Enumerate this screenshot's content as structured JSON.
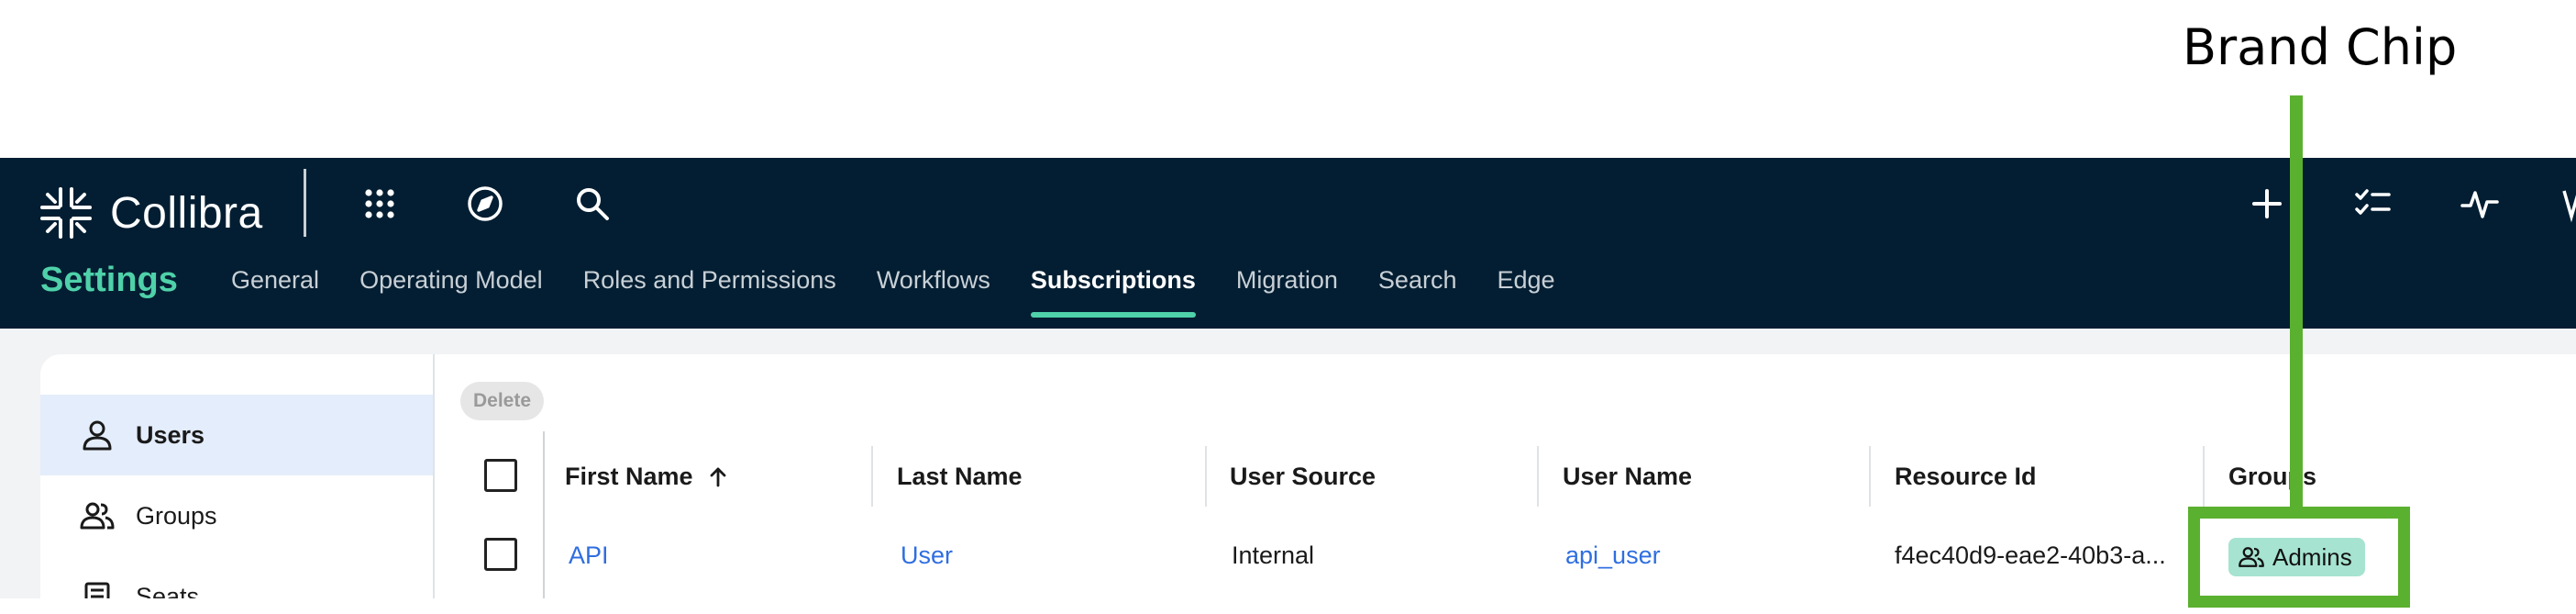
{
  "annotation": {
    "label": "Brand Chip",
    "color": "#5ab02f"
  },
  "app": {
    "name": "Collibra",
    "colors": {
      "header_bg": "#031e32",
      "accent": "#4fd1a9",
      "link": "#2f6ee0",
      "chip_bg": "#a6e3d0"
    },
    "header_icons": [
      "apps-grid-icon",
      "compass-icon",
      "search-icon",
      "plus-icon",
      "tasks-checklist-icon",
      "activity-pulse-icon"
    ]
  },
  "settings": {
    "title": "Settings",
    "tabs": [
      {
        "label": "General"
      },
      {
        "label": "Operating Model"
      },
      {
        "label": "Roles and Permissions"
      },
      {
        "label": "Workflows"
      },
      {
        "label": "Subscriptions",
        "active": true
      },
      {
        "label": "Migration"
      },
      {
        "label": "Search"
      },
      {
        "label": "Edge"
      }
    ]
  },
  "sidebar": {
    "items": [
      {
        "label": "Users",
        "icon": "user-icon",
        "active": true
      },
      {
        "label": "Groups",
        "icon": "users-group-icon"
      },
      {
        "label": "Seats",
        "icon": "seats-icon"
      }
    ]
  },
  "table": {
    "delete_label": "Delete",
    "columns": [
      "First Name",
      "Last Name",
      "User Source",
      "User Name",
      "Resource Id",
      "Groups"
    ],
    "sorted_column": "First Name",
    "sort_direction": "ascending",
    "rows": [
      {
        "first_name": "API",
        "last_name": "User",
        "user_source": "Internal",
        "user_name": "api_user",
        "resource_id": "f4ec40d9-eae2-40b3-a...",
        "groups": [
          "Admins"
        ]
      }
    ]
  }
}
